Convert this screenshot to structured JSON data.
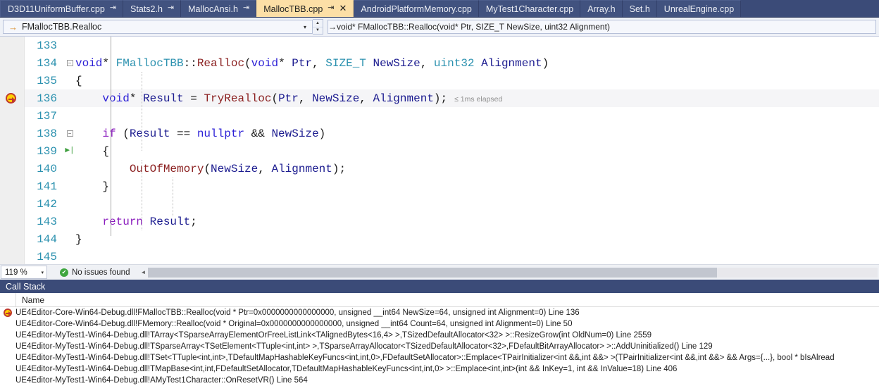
{
  "tabs": [
    {
      "label": "D3D11UniformBuffer.cpp",
      "pinned": true,
      "active": false,
      "closable": false
    },
    {
      "label": "Stats2.h",
      "pinned": true,
      "active": false,
      "closable": false
    },
    {
      "label": "MallocAnsi.h",
      "pinned": true,
      "active": false,
      "closable": false
    },
    {
      "label": "MallocTBB.cpp",
      "pinned": true,
      "active": true,
      "closable": true
    },
    {
      "label": "AndroidPlatformMemory.cpp",
      "pinned": false,
      "active": false,
      "closable": false
    },
    {
      "label": "MyTest1Character.cpp",
      "pinned": false,
      "active": false,
      "closable": false
    },
    {
      "label": "Array.h",
      "pinned": false,
      "active": false,
      "closable": false
    },
    {
      "label": "Set.h",
      "pinned": false,
      "active": false,
      "closable": false
    },
    {
      "label": "UnrealEngine.cpp",
      "pinned": false,
      "active": false,
      "closable": false
    }
  ],
  "icons": {
    "pin": "⇥",
    "close": "✕",
    "arrow_right": "→",
    "caret_down": "▾",
    "spin_up": "▲",
    "spin_down": "▼",
    "check": "✔",
    "scroll_left": "◄",
    "run_to_cursor": "▶|"
  },
  "navbar": {
    "scope_value": "FMallocTBB.Realloc",
    "member_value": "void* FMallocTBB::Realloc(void* Ptr, SIZE_T NewSize, uint32 Alignment)"
  },
  "editor": {
    "lines": [
      {
        "num": "133",
        "text": "",
        "tokens": []
      },
      {
        "num": "134",
        "collapse": "minus",
        "tokens": [
          {
            "t": "void",
            "c": "kw"
          },
          {
            "t": "* ",
            "c": "op"
          },
          {
            "t": "FMallocTBB",
            "c": "typ"
          },
          {
            "t": "::",
            "c": "op"
          },
          {
            "t": "Realloc",
            "c": "fn"
          },
          {
            "t": "(",
            "c": "op"
          },
          {
            "t": "void",
            "c": "kw"
          },
          {
            "t": "* ",
            "c": "op"
          },
          {
            "t": "Ptr",
            "c": "pl"
          },
          {
            "t": ", ",
            "c": "op"
          },
          {
            "t": "SIZE_T",
            "c": "typ"
          },
          {
            "t": " ",
            "c": "op"
          },
          {
            "t": "NewSize",
            "c": "pl"
          },
          {
            "t": ", ",
            "c": "op"
          },
          {
            "t": "uint32",
            "c": "typ"
          },
          {
            "t": " ",
            "c": "op"
          },
          {
            "t": "Alignment",
            "c": "pl"
          },
          {
            "t": ")",
            "c": "op"
          }
        ]
      },
      {
        "num": "135",
        "tokens": [
          {
            "t": "{",
            "c": "op"
          }
        ]
      },
      {
        "num": "136",
        "breakpoint": true,
        "current": true,
        "elapsed": "≤ 1ms elapsed",
        "tokens": [
          {
            "t": "    ",
            "c": "op"
          },
          {
            "t": "void",
            "c": "kw"
          },
          {
            "t": "* ",
            "c": "op"
          },
          {
            "t": "Result",
            "c": "pl"
          },
          {
            "t": " = ",
            "c": "op"
          },
          {
            "t": "TryRealloc",
            "c": "fn"
          },
          {
            "t": "(",
            "c": "op"
          },
          {
            "t": "Ptr",
            "c": "pl"
          },
          {
            "t": ", ",
            "c": "op"
          },
          {
            "t": "NewSize",
            "c": "pl"
          },
          {
            "t": ", ",
            "c": "op"
          },
          {
            "t": "Alignment",
            "c": "pl"
          },
          {
            "t": ");",
            "c": "op"
          }
        ]
      },
      {
        "num": "137",
        "tokens": []
      },
      {
        "num": "138",
        "collapse": "minus",
        "tokens": [
          {
            "t": "    ",
            "c": "op"
          },
          {
            "t": "if",
            "c": "kw2"
          },
          {
            "t": " (",
            "c": "op"
          },
          {
            "t": "Result",
            "c": "pl"
          },
          {
            "t": " == ",
            "c": "op"
          },
          {
            "t": "nullptr",
            "c": "kw"
          },
          {
            "t": " && ",
            "c": "op"
          },
          {
            "t": "NewSize",
            "c": "pl"
          },
          {
            "t": ")",
            "c": "op"
          }
        ]
      },
      {
        "num": "139",
        "runto": true,
        "tokens": [
          {
            "t": "    {",
            "c": "op"
          }
        ]
      },
      {
        "num": "140",
        "tokens": [
          {
            "t": "        ",
            "c": "op"
          },
          {
            "t": "OutOfMemory",
            "c": "fn"
          },
          {
            "t": "(",
            "c": "op"
          },
          {
            "t": "NewSize",
            "c": "pl"
          },
          {
            "t": ", ",
            "c": "op"
          },
          {
            "t": "Alignment",
            "c": "pl"
          },
          {
            "t": ");",
            "c": "op"
          }
        ]
      },
      {
        "num": "141",
        "tokens": [
          {
            "t": "    }",
            "c": "op"
          }
        ]
      },
      {
        "num": "142",
        "tokens": []
      },
      {
        "num": "143",
        "tokens": [
          {
            "t": "    ",
            "c": "op"
          },
          {
            "t": "return",
            "c": "kw2"
          },
          {
            "t": " ",
            "c": "op"
          },
          {
            "t": "Result",
            "c": "pl"
          },
          {
            "t": ";",
            "c": "op"
          }
        ]
      },
      {
        "num": "144",
        "tokens": [
          {
            "t": "}",
            "c": "op"
          }
        ]
      },
      {
        "num": "145",
        "tokens": []
      }
    ]
  },
  "status": {
    "zoom": "119 %",
    "issues": "No issues found"
  },
  "callstack": {
    "title": "Call Stack",
    "column_name": "Name",
    "rows": [
      {
        "current": true,
        "text": "UE4Editor-Core-Win64-Debug.dll!FMallocTBB::Realloc(void * Ptr=0x0000000000000000, unsigned __int64 NewSize=64, unsigned int Alignment=0) Line 136"
      },
      {
        "current": false,
        "text": "UE4Editor-Core-Win64-Debug.dll!FMemory::Realloc(void * Original=0x0000000000000000, unsigned __int64 Count=64, unsigned int Alignment=0) Line 50"
      },
      {
        "current": false,
        "text": "UE4Editor-MyTest1-Win64-Debug.dll!TArray<TSparseArrayElementOrFreeListLink<TAlignedBytes<16,4> >,TSizedDefaultAllocator<32> >::ResizeGrow(int OldNum=0) Line 2559"
      },
      {
        "current": false,
        "text": "UE4Editor-MyTest1-Win64-Debug.dll!TSparseArray<TSetElement<TTuple<int,int> >,TSparseArrayAllocator<TSizedDefaultAllocator<32>,FDefaultBitArrayAllocator> >::AddUninitialized() Line 129"
      },
      {
        "current": false,
        "text": "UE4Editor-MyTest1-Win64-Debug.dll!TSet<TTuple<int,int>,TDefaultMapHashableKeyFuncs<int,int,0>,FDefaultSetAllocator>::Emplace<TPairInitializer<int &&,int &&> >(TPairInitializer<int &&,int &&> && Args={...}, bool * bIsAlread"
      },
      {
        "current": false,
        "text": "UE4Editor-MyTest1-Win64-Debug.dll!TMapBase<int,int,FDefaultSetAllocator,TDefaultMapHashableKeyFuncs<int,int,0> >::Emplace<int,int>(int && InKey=1, int && InValue=18) Line 406"
      },
      {
        "current": false,
        "text": "UE4Editor-MyTest1-Win64-Debug.dll!AMyTest1Character::OnResetVR() Line 564"
      }
    ]
  }
}
